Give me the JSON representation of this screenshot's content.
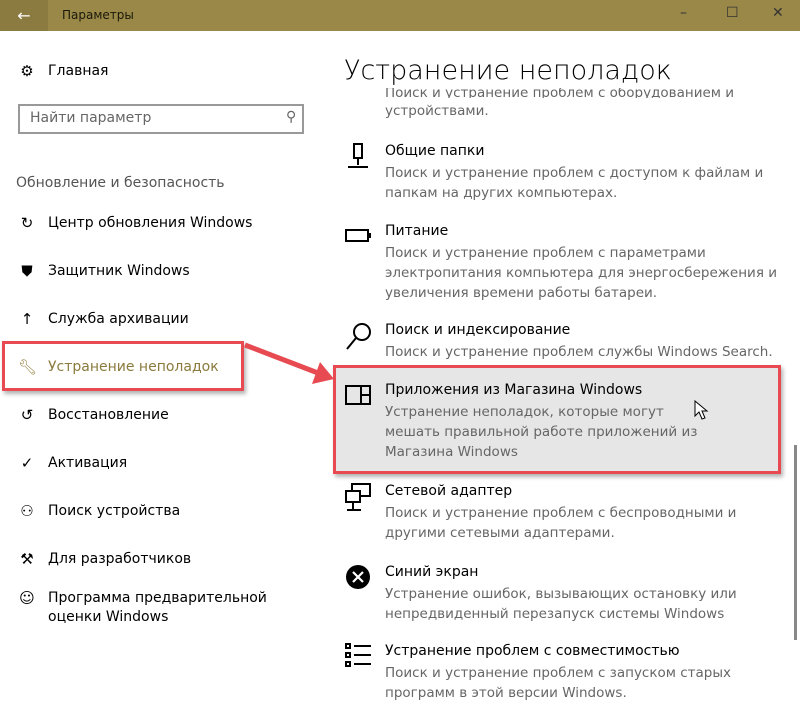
{
  "window": {
    "title": "Параметры",
    "back_icon": "arrow-left-icon",
    "minimize": "–",
    "maximize": "☐",
    "close": "✕"
  },
  "sidebar": {
    "home": "Главная",
    "search_placeholder": "Найти параметр",
    "section": "Обновление и безопасность",
    "items": [
      {
        "label": "Центр обновления Windows",
        "icon": "sync-icon"
      },
      {
        "label": "Защитник Windows",
        "icon": "shield-icon"
      },
      {
        "label": "Служба архивации",
        "icon": "backup-icon"
      },
      {
        "label": "Устранение неполадок",
        "icon": "wrench-icon",
        "selected": true
      },
      {
        "label": "Восстановление",
        "icon": "history-icon"
      },
      {
        "label": "Активация",
        "icon": "check-circle-icon"
      },
      {
        "label": "Поиск устройства",
        "icon": "person-search-icon"
      },
      {
        "label": "Для разработчиков",
        "icon": "developer-icon"
      },
      {
        "label": "Программа предварительной оценки Windows",
        "icon": "insider-icon"
      }
    ]
  },
  "main": {
    "title": "Устранение неполадок",
    "partial_desc": [
      "Поиск и устранение проблем с оборудованием и",
      "устройствами."
    ],
    "items": [
      {
        "title": "Общие папки",
        "desc": "Поиск и устранение проблем с доступом к файлам и папкам на других компьютерах."
      },
      {
        "title": "Питание",
        "desc": "Поиск и устранение проблем с параметрами электропитания компьютера для энергосбережения и увеличения  времени работы батареи."
      },
      {
        "title": "Поиск и индексирование",
        "desc": "Поиск и устранение проблем службы Windows Search."
      },
      {
        "title": "Приложения из Магазина Windows",
        "desc": "Устранение неполадок, которые могут мешать правильной работе приложений из Магазина Windows"
      },
      {
        "title": "Сетевой адаптер",
        "desc": "Поиск и устранение проблем с беспроводными и другими сетевыми адаптерами."
      },
      {
        "title": "Синий экран",
        "desc": "Устранение ошибок, вызывающих остановку или непредвиденный перезапуск системы Windows"
      },
      {
        "title": "Устранение проблем с совместимостью",
        "desc": "Поиск и устранение проблем с запуском старых программ в этой версии Windows."
      }
    ]
  },
  "colors": {
    "titlebar": "#9a8849",
    "highlight": "#e84a52",
    "accent": "#9a8849"
  }
}
